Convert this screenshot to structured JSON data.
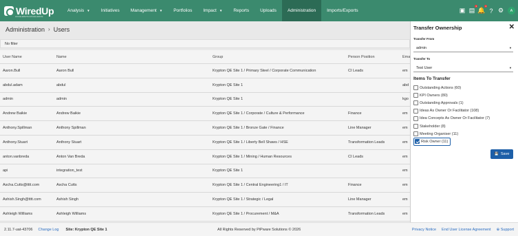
{
  "brand": {
    "name": "WiredUp",
    "tagline": "ACCELERATE EXCELLENCE"
  },
  "nav": [
    {
      "label": "Analysis",
      "caret": true
    },
    {
      "label": "Initiatives",
      "caret": false
    },
    {
      "label": "Management",
      "caret": true
    },
    {
      "label": "Portfolios",
      "caret": false
    },
    {
      "label": "Impact",
      "caret": true
    },
    {
      "label": "Reports",
      "caret": false
    },
    {
      "label": "Uploads",
      "caret": false
    },
    {
      "label": "Administration",
      "caret": false,
      "active": true
    },
    {
      "label": "Imports/Exports",
      "caret": false
    }
  ],
  "nav_icons": {
    "badge1": "1",
    "badge2": "1",
    "avatar": "A"
  },
  "breadcrumb": {
    "root": "Administration",
    "current": "Users"
  },
  "filter": {
    "text": "No filter"
  },
  "table": {
    "columns": [
      "User Name",
      "Name",
      "Group",
      "Person Position",
      "Email"
    ],
    "rows": [
      [
        "Aaron.Bull",
        "Aaron Bull",
        "Krypton QE Site 1 / Primary Steel / Corporate Communication",
        "CI Leads",
        "em"
      ],
      [
        "abdul.adam",
        "abdul",
        "Krypton QE Site 1",
        "",
        "abd"
      ],
      [
        "admin",
        "admin",
        "Krypton QE Site 1",
        "",
        "kgo"
      ],
      [
        "Andrew Baikie",
        "Andrew Baikie",
        "Krypton QE Site 1 / Corporate / Culture & Performance",
        "Finance",
        "em"
      ],
      [
        "Anthony.Spillman",
        "Anthony Spillman",
        "Krypton QE Site 1 / Bronze Gate / Finance",
        "Line Manager",
        "em"
      ],
      [
        "Anthony.Stuart",
        "Anthony Stuart",
        "Krypton QE Site 1 / Liberty Bell Shaws / HSE",
        "Transformation Leads",
        "em"
      ],
      [
        "anton.vanbreda",
        "Anton Van Breda",
        "Krypton QE Site 1 / Mining / Human Resources",
        "CI Leads",
        "em"
      ],
      [
        "api",
        "integration_test",
        "Krypton QE Site 1",
        "",
        "em"
      ],
      [
        "Ascha.Cutts@tttt.com",
        "Ascha Cutts",
        "Krypton QE Site 1 / Central Engineering1 / IT",
        "Finance",
        "em"
      ],
      [
        "Ashish.Singh@tttt.com",
        "Ashish Singh",
        "Krypton QE Site 1 / Strategic / Legal",
        "Line Manager",
        "em"
      ],
      [
        "Ashleigh Williams",
        "Ashleigh Williams",
        "Krypton QE Site 1 / Procurement / M&A",
        "Transformation Leads",
        "em"
      ]
    ]
  },
  "footer": {
    "version": "2.11.7-uat-43706",
    "changelog": "Change Log",
    "site": "Site: Krypton QE Site 1",
    "copyright": "All Rights Reserved by PiPware Solutions © 2026",
    "privacy": "Privacy Notice",
    "eula": "End User License Agreement",
    "support": "Support"
  },
  "panel": {
    "title": "Transfer Ownership",
    "from_label": "Transfer From",
    "from_value": "admin",
    "to_label": "Transfer To",
    "to_value": "Test User",
    "items_title": "Items To Transfer",
    "items": [
      {
        "label": "Outstanding Actions (60)",
        "checked": false
      },
      {
        "label": "KPI Owners (80)",
        "checked": false
      },
      {
        "label": "Outstanding Approvals (1)",
        "checked": false
      },
      {
        "label": "Ideas As Owner Or Facilitator (108)",
        "checked": false
      },
      {
        "label": "Idea Concepts As Owner Or Facilitator (7)",
        "checked": false
      },
      {
        "label": "Stakeholder (8)",
        "checked": false
      },
      {
        "label": "Meeting Organiser (11)",
        "checked": false
      },
      {
        "label": "Risk Owner (11)",
        "checked": true
      }
    ],
    "save_label": "Save"
  }
}
